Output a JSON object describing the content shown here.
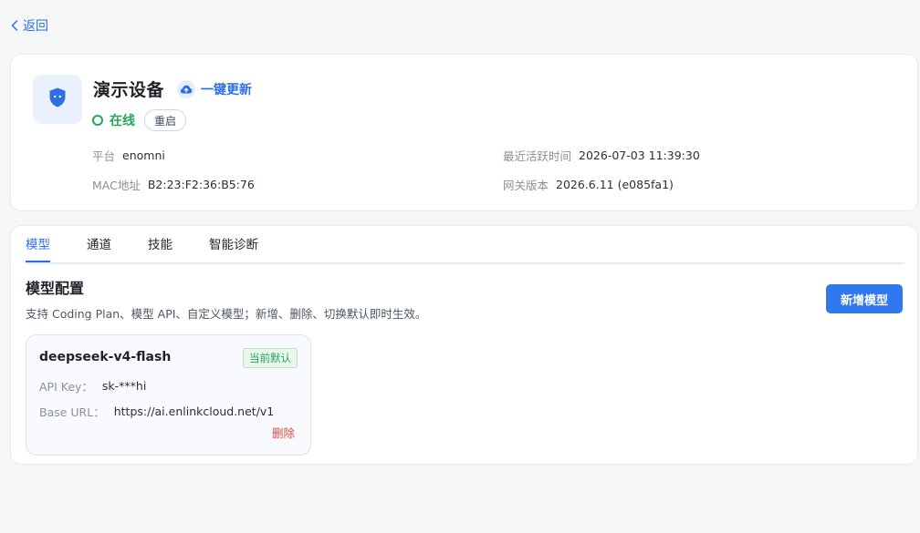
{
  "nav": {
    "back_label": "返回",
    "back_icon": "chevron-left-icon"
  },
  "device": {
    "icon": "shield-icon",
    "title": "演示设备",
    "update_label": "一键更新",
    "update_icon": "cloud-upload-icon",
    "status": "在线",
    "status_color": "#25a55a",
    "restart_label": "重启",
    "info": {
      "platform_key": "平台",
      "platform_value": "enomni",
      "last_active_key": "最近活跃时间",
      "last_active_value": "2026-07-03 11:39:30",
      "mac_key": "MAC地址",
      "mac_value": "B2:23:F2:36:B5:76",
      "gateway_key": "网关版本",
      "gateway_value": "2026.6.11 (e085fa1)"
    }
  },
  "tabs": [
    {
      "label": "模型",
      "active": true
    },
    {
      "label": "通道",
      "active": false
    },
    {
      "label": "技能",
      "active": false
    },
    {
      "label": "智能诊断",
      "active": false
    }
  ],
  "section": {
    "title": "模型配置",
    "description": "支持 Coding Plan、模型 API、自定义模型；新增、删除、切换默认即时生效。",
    "add_button_label": "新增模型"
  },
  "models": [
    {
      "name": "deepseek-v4-flash",
      "badge": "当前默认",
      "api_key_label": "API Key：",
      "api_key_value": "sk-***hi",
      "base_url_label": "Base URL：",
      "base_url_value": "https://ai.enlinkcloud.net/v1",
      "delete_label": "删除"
    }
  ],
  "colors": {
    "accent": "#2f6fe4",
    "primary_button": "#2f78ee",
    "success": "#25a55a",
    "danger": "#e5483f"
  }
}
